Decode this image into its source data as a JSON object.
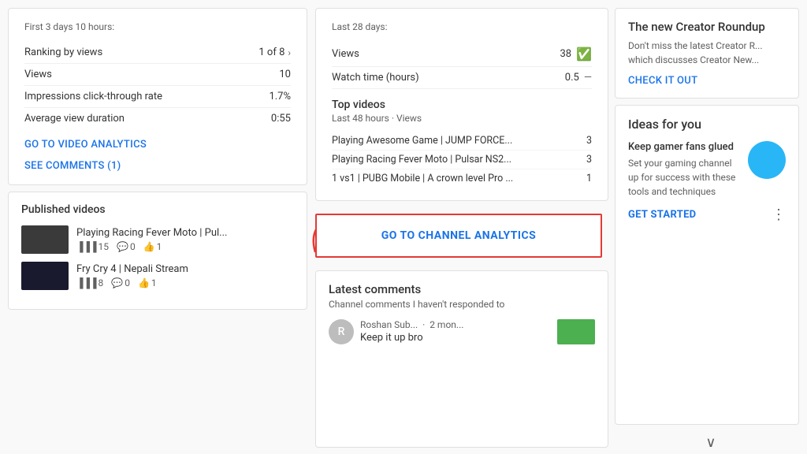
{
  "left": {
    "analytics_card": {
      "title": "First 3 days 10 hours:",
      "stats": [
        {
          "label": "Ranking by views",
          "value": "1 of 8",
          "has_arrow": true
        },
        {
          "label": "Views",
          "value": "10",
          "has_arrow": false
        },
        {
          "label": "Impressions click-through rate",
          "value": "1.7%",
          "has_arrow": false
        },
        {
          "label": "Average view duration",
          "value": "0:55",
          "has_arrow": false
        }
      ],
      "link1": "GO TO VIDEO ANALYTICS",
      "link2": "SEE COMMENTS (1)"
    },
    "published_card": {
      "title": "Published videos",
      "videos": [
        {
          "title": "Playing Racing Fever Moto | Pul...",
          "views": "15",
          "comments": "0",
          "likes": "1",
          "thumb_color": "#3a3a3a"
        },
        {
          "title": "Fry Cry 4 | Nepali Stream",
          "views": "8",
          "comments": "0",
          "likes": "1",
          "thumb_color": "#1a1a2e"
        }
      ]
    }
  },
  "middle": {
    "channel_stats": {
      "period": "Last 28 days:",
      "stats": [
        {
          "label": "Views",
          "value": "38",
          "icon": "check"
        },
        {
          "label": "Watch time (hours)",
          "value": "0.5",
          "icon": "dash"
        }
      ]
    },
    "top_videos": {
      "title": "Top videos",
      "subtitle": "Last 48 hours · Views",
      "items": [
        {
          "name": "Playing Awesome Game | JUMP FORCE...",
          "count": "3"
        },
        {
          "name": "Playing Racing Fever Moto | Pulsar NS2...",
          "count": "3"
        },
        {
          "name": "1 vs1 | PUBG Mobile | A crown level Pro ...",
          "count": "1"
        }
      ]
    },
    "channel_analytics_btn": "GO TO CHANNEL ANALYTICS",
    "latest_comments": {
      "title": "Latest comments",
      "subtitle": "Channel comments I haven't responded to",
      "comment": {
        "author": "Roshan Sub...",
        "time": "2 mon...",
        "text": "Keep it up bro",
        "thumb_color": "#4caf50"
      }
    }
  },
  "right": {
    "creator_roundup": {
      "title": "The new Creator Roundup",
      "description": "Don't miss the latest Creator R... which discusses Creator New...",
      "link": "CHECK IT OUT"
    },
    "ideas": {
      "title": "Ideas for you",
      "item_title": "Keep gamer fans glued",
      "item_desc": "Set your gaming channel up for success with these tools and techniques",
      "link": "GET STARTED",
      "more": "⋮",
      "chevron": "∨"
    }
  }
}
